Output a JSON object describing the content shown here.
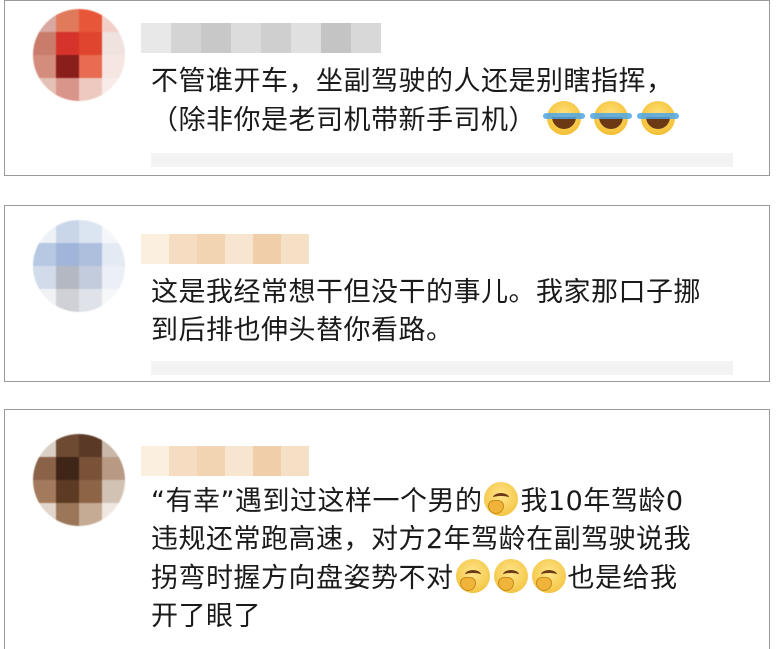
{
  "comments": [
    {
      "line1": "不管谁开车，坐副驾驶的人还是别瞎指挥，",
      "line2": "（除非你是老司机带新手司机）",
      "emoji_line2": [
        "laugh-crying-emoji",
        "laugh-crying-emoji",
        "laugh-crying-emoji"
      ]
    },
    {
      "line1": "这是我经常想干但没干的事儿。我家那口子挪",
      "line2": "到后排也伸头替你看路。"
    },
    {
      "line1a": "“有幸”遇到过这样一个男的",
      "line1b": "我10年驾龄0",
      "line2": "违规还常跑高速，对方2年驾龄在副驾驶说我",
      "line3a": "拐弯时握方向盘姿势不对",
      "line3b": "也是给我",
      "line4": "开了眼了"
    }
  ],
  "colors": {
    "card_border": "#9a9a9a",
    "text": "#1a1a1a",
    "emoji_yellow": "#f5c23a"
  }
}
